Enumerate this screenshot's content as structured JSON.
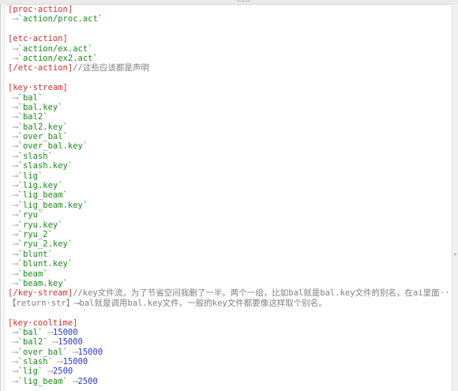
{
  "window": {
    "top_tab_text": "⋯⋯⋯"
  },
  "blocks": [
    {
      "type": "section",
      "tag": "[proc·action]"
    },
    {
      "type": "item",
      "value": "`action/proc.act`"
    },
    {
      "type": "blank"
    },
    {
      "type": "section",
      "tag": "[etc·action]"
    },
    {
      "type": "item",
      "value": "`action/ex.act`"
    },
    {
      "type": "item",
      "value": "`action/ex2.act`"
    },
    {
      "type": "close",
      "tag": "[/etc·action]",
      "comment": "//这些应该都是声明"
    },
    {
      "type": "blank"
    },
    {
      "type": "section",
      "tag": "[key·stream]"
    },
    {
      "type": "item",
      "value": "`bal`"
    },
    {
      "type": "item",
      "value": "`bal.key`"
    },
    {
      "type": "item",
      "value": "`bal2`"
    },
    {
      "type": "item",
      "value": "`bal2.key`"
    },
    {
      "type": "item",
      "value": "`over_bal`"
    },
    {
      "type": "item",
      "value": "`over_bal.key`"
    },
    {
      "type": "item",
      "value": "`slash`"
    },
    {
      "type": "item",
      "value": "`slash.key`"
    },
    {
      "type": "item",
      "value": "`lig`"
    },
    {
      "type": "item",
      "value": "`lig.key`"
    },
    {
      "type": "item",
      "value": "`lig_beam`"
    },
    {
      "type": "item",
      "value": "`lig_beam.key`"
    },
    {
      "type": "item",
      "value": "`ryu`"
    },
    {
      "type": "item",
      "value": "`ryu.key`"
    },
    {
      "type": "item",
      "value": "`ryu_2`"
    },
    {
      "type": "item",
      "value": "`ryu_2.key`"
    },
    {
      "type": "item",
      "value": "`blunt`"
    },
    {
      "type": "item",
      "value": "`blunt.key`"
    },
    {
      "type": "item",
      "value": "`beam`"
    },
    {
      "type": "item",
      "value": "`beam.key`"
    },
    {
      "type": "close",
      "tag": "[/key·stream]",
      "comment": "//key文件流，为了节省空间我删了一半。两个一组，比如bal就是bal.key文件的别名，在ai里面··【return·str】⟶bal就是调用bal.key文件。一般的key文件都要像这样取个别名。"
    },
    {
      "type": "blank"
    },
    {
      "type": "section",
      "tag": "[key·cooltime]"
    },
    {
      "type": "kv",
      "key": "`bal`",
      "num": "15000"
    },
    {
      "type": "kv",
      "key": "`bal2`",
      "num": "15000"
    },
    {
      "type": "kv",
      "key": "`over_bal`",
      "num": "15000"
    },
    {
      "type": "kv",
      "key": "`slash`",
      "num": "15000"
    },
    {
      "type": "kv",
      "key": "`lig`",
      "num": "2500"
    },
    {
      "type": "kv",
      "key": "`lig_beam`",
      "num": "2500"
    }
  ]
}
